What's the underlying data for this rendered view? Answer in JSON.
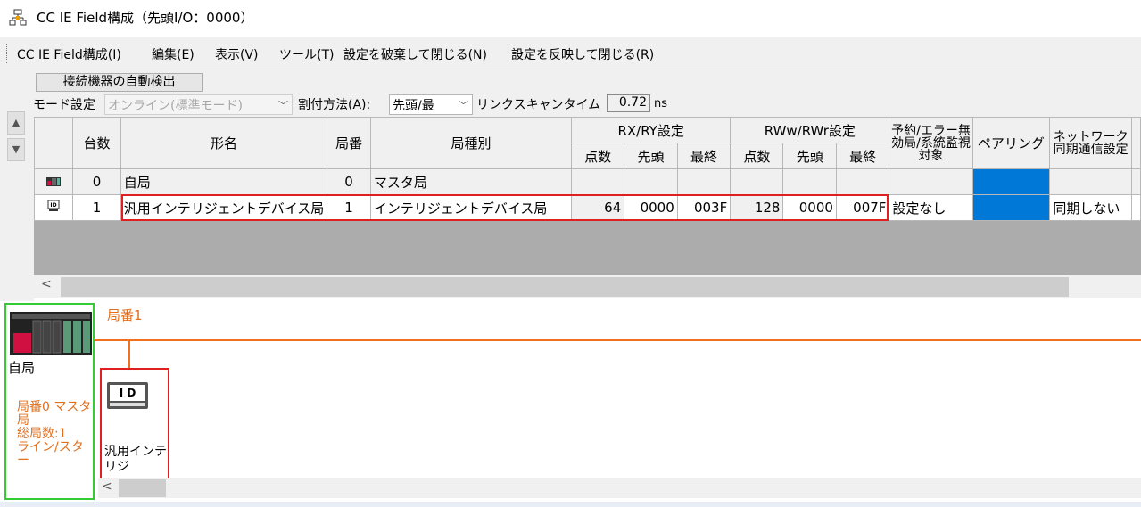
{
  "window": {
    "title": "CC IE Field構成（先頭I/O：0000）",
    "icon": "network-config-icon"
  },
  "menu": [
    "CC IE Field構成(I)",
    "編集(E)",
    "表示(V)",
    "ツール(T)",
    "設定を破棄して閉じる(N)",
    "設定を反映して閉じる(R)"
  ],
  "toolbar": {
    "auto_detect_button": "接続機器の自動検出",
    "mode_label": "モード設定",
    "mode_value": "オンライン(標準モード)",
    "assign_label": "割付方法(A):",
    "assign_value": "先頭/最",
    "link_scan_label": "リンクスキャンタイム（",
    "link_scan_value": "0.72",
    "link_scan_unit": "ns"
  },
  "grid": {
    "headers": {
      "count": "台数",
      "model": "形名",
      "station_no": "局番",
      "station_type": "局種別",
      "rxry": "RX/RY設定",
      "rww": "RWw/RWr設定",
      "points": "点数",
      "start": "先頭",
      "end": "最終",
      "reserved": "予約/エラー無効局/系統監視対象",
      "pairing": "ペアリング",
      "network_sync": "ネットワーク同期通信設定"
    },
    "rows": [
      {
        "icon": "master-station-icon",
        "count": "0",
        "model": "自局",
        "station_no": "0",
        "station_type": "マスタ局",
        "rx_points": "",
        "rx_start": "",
        "rx_end": "",
        "rw_points": "",
        "rw_start": "",
        "rw_end": "",
        "reserved": "",
        "network_sync": ""
      },
      {
        "icon": "intelligent-device-icon",
        "count": "1",
        "model": "汎用インテリジェントデバイス局",
        "station_no": "1",
        "station_type": "インテリジェントデバイス局",
        "rx_points": "64",
        "rx_start": "0000",
        "rx_end": "003F",
        "rw_points": "128",
        "rw_start": "0000",
        "rw_end": "007F",
        "reserved": "設定なし",
        "network_sync": "同期しない"
      }
    ]
  },
  "network": {
    "line_label": "局番1",
    "master_label": "自局",
    "master_info": "局番0 マスタ局\n総局数:1\nライン/スター",
    "device_badge": "I D",
    "device_label": "汎用インテリジ",
    "colors": {
      "line": "#f07020",
      "selection_red": "#e02020",
      "selection_green": "#33cc33",
      "pairing_blue": "#0078d7"
    }
  }
}
